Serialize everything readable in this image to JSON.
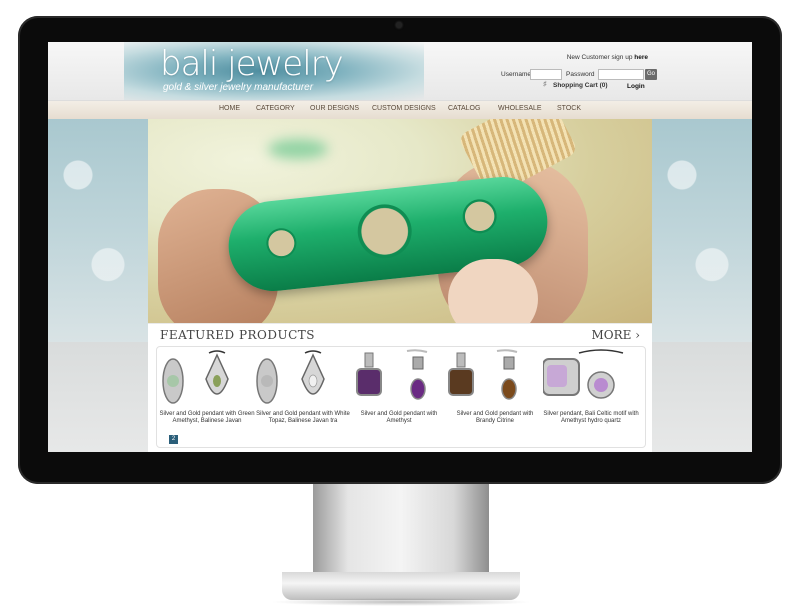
{
  "header": {
    "logo_title": "bali jewelry",
    "logo_subtitle": "gold & silver jewelry manufacturer",
    "signup_text": "New Customer sign up",
    "signup_link": "here",
    "username_label": "Username",
    "password_label": "Password",
    "go_label": "Go",
    "cart_label": "Shopping Cart (0)",
    "login_label": "Login"
  },
  "nav": {
    "items": [
      "HOME",
      "CATEGORY",
      "OUR DESIGNS",
      "CUSTOM DESIGNS",
      "CATALOG",
      "WHOLESALE",
      "STOCK"
    ]
  },
  "featured": {
    "title": "FEATURED PRODUCTS",
    "more_label": "MORE ›",
    "page": "2",
    "products": [
      {
        "name": "Silver and Gold pendant with Green Amethyst, Balinese Javan"
      },
      {
        "name": "Silver and Gold pendant with White Topaz, Balinese Javan tra"
      },
      {
        "name": "Silver and Gold pendant with Amethyst"
      },
      {
        "name": "Silver and Gold pendant with Brandy Citrine"
      },
      {
        "name": "Silver pendant, Bali Celtic motif with Amethyst hydro quartz"
      }
    ]
  },
  "colors": {
    "bezel": "#0b0b0b",
    "accent_teal": "#4f8ea0",
    "jade": "#1eaf6c"
  }
}
